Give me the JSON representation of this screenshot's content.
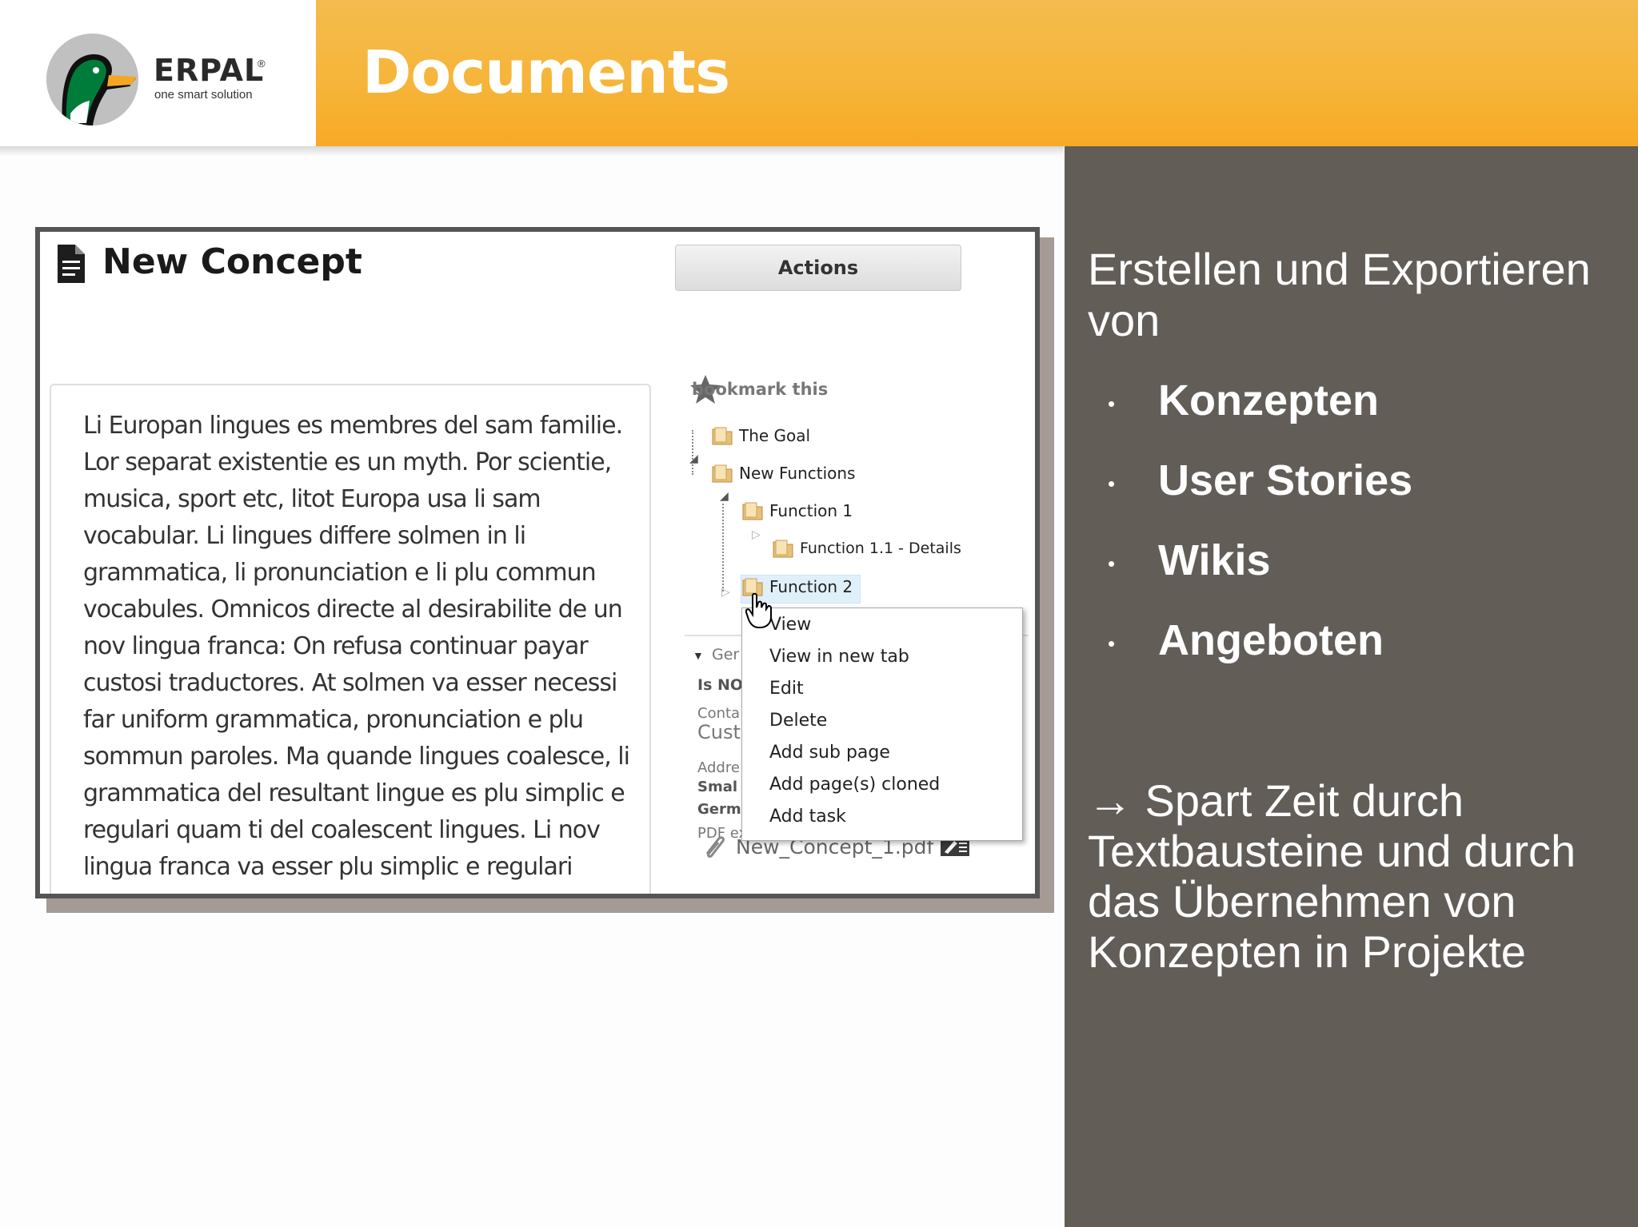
{
  "header": {
    "brand_name": "ERPAL",
    "brand_reg": "®",
    "brand_tagline": "one smart solution",
    "page_title": "Documents"
  },
  "colors": {
    "header_orange": "#f6b53a",
    "panel_gray": "#625d57"
  },
  "screenshot": {
    "doc_title": "New Concept",
    "actions_label": "Actions",
    "body_text": "Li Europan lingues es membres del sam familie. Lor separat existentie es un myth. Por scientie, musica, sport etc, litot Europa usa li sam vocabular. Li lingues differe solmen in li grammatica, li pronunciation e li plu commun vocabules. Omnicos directe al desirabilite de un nov lingua franca: On refusa continuar payar custosi traductores. At solmen va esser necessi far uniform grammatica, pronunciation e plu sommun paroles. Ma quande lingues coalesce, li grammatica del resultant lingue es plu simplic e regulari quam ti del coalescent lingues. Li nov lingua franca va esser plu simplic e regulari",
    "bookmark_label": "bookmark this",
    "tree": [
      {
        "label": "The Goal"
      },
      {
        "label": "New Functions"
      },
      {
        "label": "Function 1"
      },
      {
        "label": "Function 1.1 - Details"
      },
      {
        "label": "Function 2"
      }
    ],
    "meta": {
      "section_label": "Ger",
      "status_label": "Is NO",
      "contact_label": "Conta",
      "contact_value": "Cust",
      "address_label": "Addre",
      "address_line1": "Smal",
      "address_line2": "Germ",
      "pdf_exports_label": "PDF exports",
      "pdf_file": "New_Concept_1.pdf"
    },
    "context_menu": [
      {
        "label": "View"
      },
      {
        "label": "View in new tab"
      },
      {
        "label": "Edit"
      },
      {
        "label": "Delete"
      },
      {
        "label": "Add sub page"
      },
      {
        "label": "Add page(s) cloned"
      },
      {
        "label": "Add task"
      }
    ]
  },
  "right_panel": {
    "heading": "Erstellen und Exportieren von",
    "bullets": [
      "Konzepten",
      "User Stories",
      "Wikis",
      "Angeboten"
    ],
    "bullet_char": "•",
    "note": "→ Spart Zeit durch Textbausteine und durch das Übernehmen von Konzepten in Projekte"
  }
}
